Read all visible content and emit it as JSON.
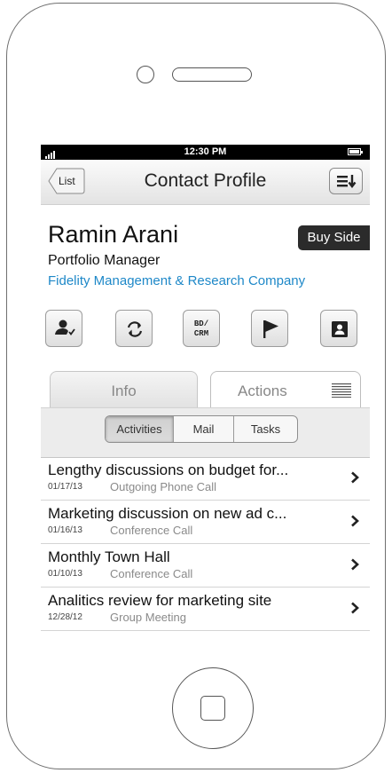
{
  "status_bar": {
    "time": "12:30 PM"
  },
  "nav": {
    "back_label": "List",
    "title": "Contact Profile"
  },
  "profile": {
    "name": "Ramin Arani",
    "tag": "Buy Side",
    "title": "Portfolio Manager",
    "company": "Fidelity Management & Research Company",
    "bd_crm_line1": "BD/",
    "bd_crm_line2": "CRM"
  },
  "segments": {
    "info": "Info",
    "actions": "Actions"
  },
  "subtabs": {
    "activities": "Activities",
    "mail": "Mail",
    "tasks": "Tasks",
    "selected": "Activities"
  },
  "activities": [
    {
      "title": "Lengthy discussions on budget for...",
      "date": "01/17/13",
      "type": "Outgoing Phone Call"
    },
    {
      "title": "Marketing discussion on new ad c...",
      "date": "01/16/13",
      "type": "Conference Call"
    },
    {
      "title": "Monthly Town Hall",
      "date": "01/10/13",
      "type": "Conference Call"
    },
    {
      "title": "Analitics  review for marketing site",
      "date": "12/28/12",
      "type": "Group Meeting"
    }
  ],
  "colors": {
    "link": "#1e88c8",
    "tag_bg": "#2b2b2b",
    "status_bar": "#000000"
  }
}
